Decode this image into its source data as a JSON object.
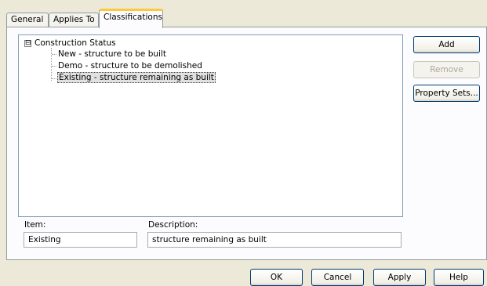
{
  "tabs": [
    {
      "label": "General"
    },
    {
      "label": "Applies To"
    },
    {
      "label": "Classifications",
      "active": true
    }
  ],
  "tree": {
    "root": {
      "label": "Construction Status",
      "expander": "⊟"
    },
    "children": [
      {
        "label": "New - structure to be built"
      },
      {
        "label": "Demo - structure to be demolished"
      },
      {
        "label": "Existing - structure remaining as built",
        "selected": true
      }
    ]
  },
  "side_buttons": {
    "add": "Add",
    "remove": "Remove",
    "property_sets": "Property Sets..."
  },
  "item": {
    "label": "Item:",
    "value": "Existing"
  },
  "description": {
    "label": "Description:",
    "value": "structure remaining as built"
  },
  "dialog_buttons": {
    "ok": "OK",
    "cancel": "Cancel",
    "apply": "Apply",
    "help": "Help"
  },
  "colors": {
    "dialog_background": "#ece9d8",
    "tab_highlight": "#ffc83c",
    "button_border": "#003c74"
  }
}
